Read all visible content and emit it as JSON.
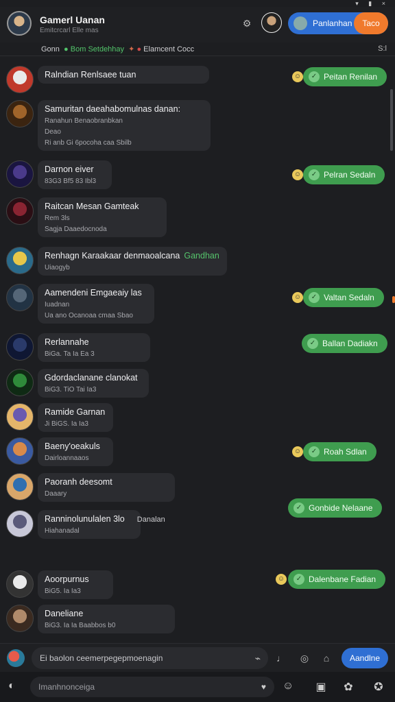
{
  "header": {
    "title": "Gamerl Uanan",
    "subtitle": "Emitcrcarl Elle mas",
    "pill_label": "Panlanhan",
    "pill_button": "Taco"
  },
  "pinned": {
    "left": "Gonn",
    "green": "Bom Setdehhay",
    "middle": "Elamcent Cocc",
    "right": "S:l"
  },
  "messages": [
    {
      "line1": "Ralndian Renlsaee tuan",
      "line2": "",
      "line3": "",
      "green_prefix": "",
      "avatar_colors": [
        "#e9e9e9",
        "#c0392b"
      ]
    },
    {
      "line1": "Samuritan daeahabomulnas danan:",
      "line2": "Ranahun Benaobranbkan",
      "line3": "Deao",
      "line4": "Ri anb Gi 6pocoha caa Sbilb",
      "avatar_colors": [
        "#a0642a",
        "#3b2410"
      ]
    },
    {
      "line1": "Darnon eiver",
      "line2": "83G3  Bf5  83 Ibl3",
      "avatar_colors": [
        "#4a3a8a",
        "#1a1540"
      ]
    },
    {
      "line1": "Raitcan Mesan Gamteak",
      "line2": "Rem 3ls",
      "line3": "Sagja  Daaedocnoda",
      "avatar_colors": [
        "#8a2432",
        "#2a0e14"
      ]
    },
    {
      "line1": "Renhagn Karaakaar denmaoalcana",
      "line1_green": "Gandhan",
      "line2": "Uiaogyb",
      "avatar_colors": [
        "#e6c74a",
        "#2a6a8a"
      ]
    },
    {
      "line1": "Aamendeni Emgaeaiy las",
      "line2": "Iuadnan",
      "line3": "Ua ano Ocanoaa cmaa Sbao",
      "avatar_colors": [
        "#556677",
        "#223344"
      ]
    },
    {
      "line1": "Rerlannahe",
      "line2": "BiGa.  Ta  Ia  Ea 3",
      "avatar_colors": [
        "#2a3a6a",
        "#0f1733"
      ]
    },
    {
      "line1": "Gdordaclanane clanokat",
      "line2": "BiG3.  TiO  Tai  Ia3",
      "avatar_colors": [
        "#2f8a3a",
        "#0f2a14"
      ]
    },
    {
      "line1": "Ramide Garnan",
      "line2": "Ji BiGS.  Ia  Ia3",
      "avatar_colors": [
        "#6a5ab0",
        "#e4b56a"
      ]
    },
    {
      "line1": "Baeny'oeakuls",
      "line2": "Dairloannaaos",
      "avatar_colors": [
        "#d88a4a",
        "#3a5aa0"
      ]
    },
    {
      "line1": "Paoranh deesomt",
      "line2": "Daaary",
      "avatar_colors": [
        "#2f6fb0",
        "#d8a66a"
      ]
    },
    {
      "line1": "Ranninolunulalen  3lo",
      "line2": "Hiahanadal",
      "line1_tail": "Danalan",
      "avatar_colors": [
        "#5a5a7a",
        "#c8c8d8"
      ]
    },
    {
      "line1": "Aoorpurnus",
      "line2": "BiG5.  Ia  Ia3",
      "avatar_colors": [
        "#eaeaea",
        "#333333"
      ]
    },
    {
      "line1": "Daneliane",
      "line2": "BiG3.  Ia  Ia  Baabbos b0",
      "avatar_colors": [
        "#b08a6a",
        "#3a2a20"
      ]
    }
  ],
  "outgoing": [
    {
      "text": "Peitan Renilan"
    },
    {
      "text": "Pelran Sedaln"
    },
    {
      "text": "Valtan Sedaln"
    },
    {
      "text": "Ballan Dadiakn"
    },
    {
      "text": "Roah Sdlan"
    },
    {
      "text": "Gonbide Nelaane"
    },
    {
      "text": "Dalenbane Fadian"
    }
  ],
  "input": {
    "placeholder": "Ei baolon ceemerpegepmoenagin",
    "send_label": "Aandlne"
  },
  "bottom": {
    "placeholder": "Imanhnonceiga"
  }
}
